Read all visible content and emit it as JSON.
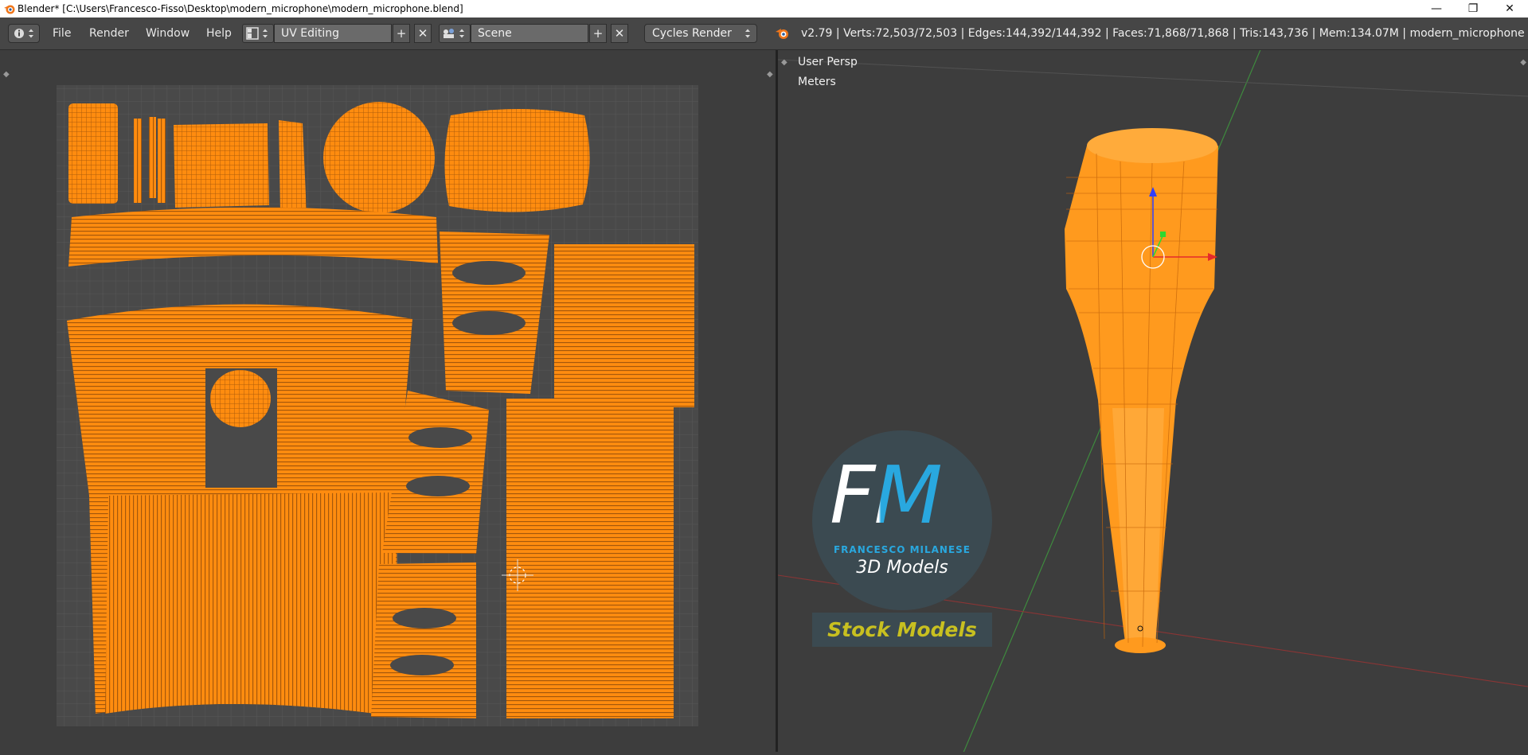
{
  "window": {
    "title": "Blender* [C:\\Users\\Francesco-Fisso\\Desktop\\modern_microphone\\modern_microphone.blend]",
    "controls": [
      "—",
      "❐",
      "✕"
    ]
  },
  "menu": [
    "File",
    "Render",
    "Window",
    "Help"
  ],
  "screen_layout": {
    "value": "UV Editing",
    "add_symbol": "+",
    "close_symbol": "✕"
  },
  "scene": {
    "value": "Scene",
    "add_symbol": "+",
    "close_symbol": "✕"
  },
  "render_engine": {
    "value": "Cycles Render"
  },
  "stats": "v2.79 | Verts:72,503/72,503 | Edges:144,392/144,392 | Faces:71,868/71,868 | Tris:143,736 | Mem:134.07M | modern_microphone",
  "viewport": {
    "view_label": "User Persp",
    "units_label": "Meters"
  },
  "watermark": {
    "logo_letters": "FM",
    "name": "FRANCESCO MILANESE",
    "subtitle": "3D Models",
    "banner": "Stock Models"
  },
  "colors": {
    "accent_orange": "#ff8c0f",
    "header_bg": "#464646",
    "area_bg": "#3d3d3d",
    "uv_bg": "#494949",
    "logo_blue": "#29a8df",
    "banner_yellow": "#c8c020"
  },
  "icons": {
    "info": "info-icon",
    "layout": "screen-layout-icon",
    "scene": "scene-icon",
    "blender": "blender-logo-icon"
  }
}
